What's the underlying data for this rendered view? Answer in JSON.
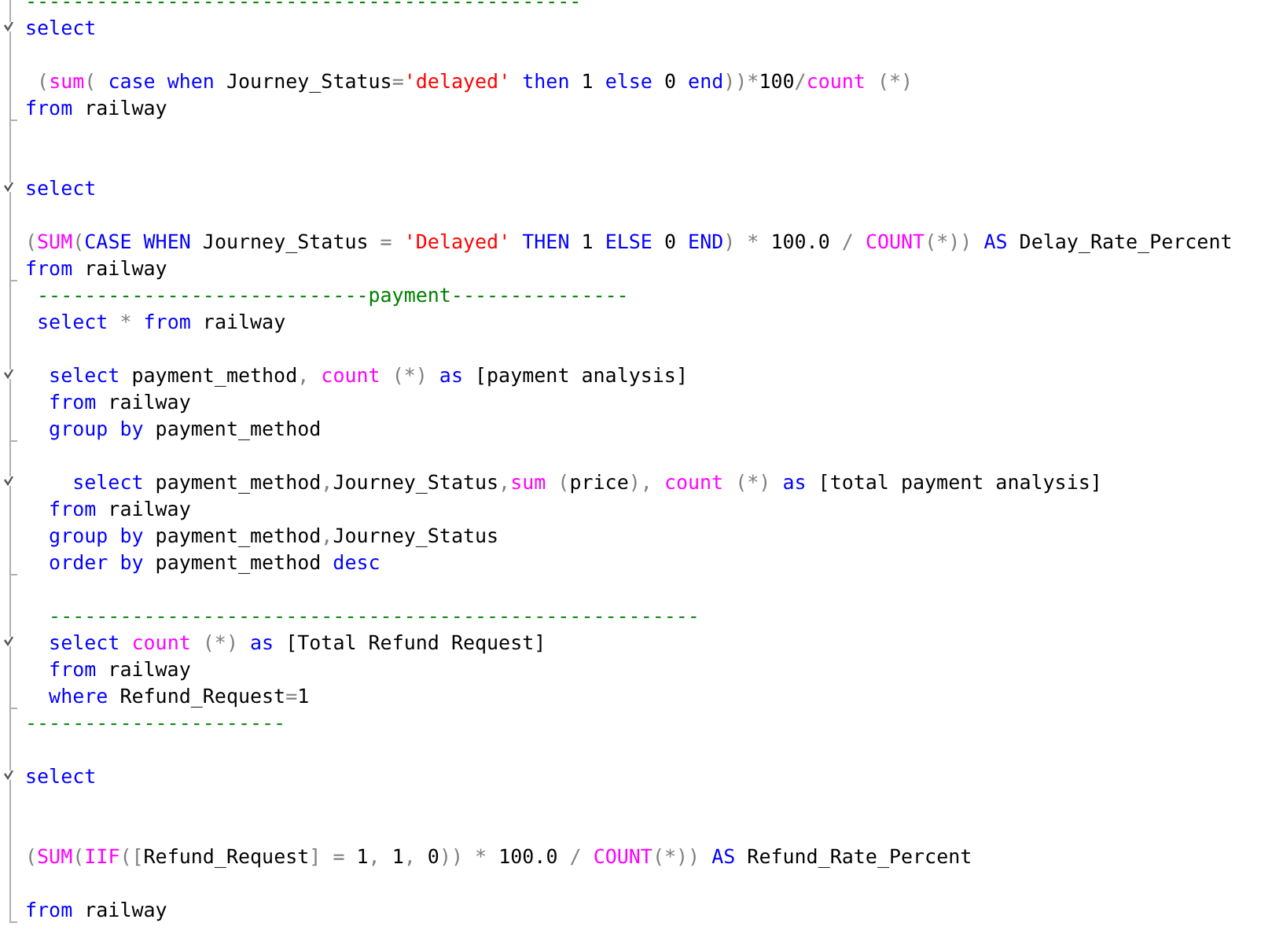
{
  "editor": {
    "lines": [
      {
        "kind": "code",
        "tokens": [
          {
            "kind": "cmt",
            "text": "-----------------------------------------------"
          }
        ]
      },
      {
        "kind": "code",
        "fold_start": true,
        "tokens": [
          {
            "kind": "kw",
            "text": "select"
          }
        ]
      },
      {
        "kind": "blank"
      },
      {
        "kind": "code",
        "tokens": [
          {
            "kind": "op",
            "text": " ("
          },
          {
            "kind": "fn",
            "text": "sum"
          },
          {
            "kind": "op",
            "text": "("
          },
          {
            "kind": "kw",
            "text": " case"
          },
          {
            "kind": "kw",
            "text": " when"
          },
          {
            "kind": "txt",
            "text": " Journey_Status"
          },
          {
            "kind": "op",
            "text": "="
          },
          {
            "kind": "str",
            "text": "'delayed'"
          },
          {
            "kind": "kw",
            "text": " then"
          },
          {
            "kind": "txt",
            "text": " 1"
          },
          {
            "kind": "kw",
            "text": " else"
          },
          {
            "kind": "txt",
            "text": " 0"
          },
          {
            "kind": "kw",
            "text": " end"
          },
          {
            "kind": "op",
            "text": "))*"
          },
          {
            "kind": "txt",
            "text": "100"
          },
          {
            "kind": "op",
            "text": "/"
          },
          {
            "kind": "fn",
            "text": "count"
          },
          {
            "kind": "op",
            "text": " (*)"
          }
        ]
      },
      {
        "kind": "code",
        "fold_end": true,
        "tokens": [
          {
            "kind": "kw",
            "text": "from"
          },
          {
            "kind": "txt",
            "text": " railway"
          }
        ]
      },
      {
        "kind": "blank"
      },
      {
        "kind": "blank"
      },
      {
        "kind": "code",
        "fold_start": true,
        "tokens": [
          {
            "kind": "kw",
            "text": "select"
          }
        ]
      },
      {
        "kind": "blank"
      },
      {
        "kind": "code",
        "tokens": [
          {
            "kind": "op",
            "text": "("
          },
          {
            "kind": "fn",
            "text": "SUM"
          },
          {
            "kind": "op",
            "text": "("
          },
          {
            "kind": "kw",
            "text": "CASE"
          },
          {
            "kind": "kw",
            "text": " WHEN"
          },
          {
            "kind": "txt",
            "text": " Journey_Status"
          },
          {
            "kind": "op",
            "text": " ="
          },
          {
            "kind": "str",
            "text": " 'Delayed'"
          },
          {
            "kind": "kw",
            "text": " THEN"
          },
          {
            "kind": "txt",
            "text": " 1"
          },
          {
            "kind": "kw",
            "text": " ELSE"
          },
          {
            "kind": "txt",
            "text": " 0"
          },
          {
            "kind": "kw",
            "text": " END"
          },
          {
            "kind": "op",
            "text": ") *"
          },
          {
            "kind": "txt",
            "text": " 100.0"
          },
          {
            "kind": "op",
            "text": " /"
          },
          {
            "kind": "fn",
            "text": " COUNT"
          },
          {
            "kind": "op",
            "text": "(*))"
          },
          {
            "kind": "kw",
            "text": " AS"
          },
          {
            "kind": "txt",
            "text": " Delay_Rate_Percent"
          }
        ]
      },
      {
        "kind": "code",
        "fold_end": true,
        "tokens": [
          {
            "kind": "kw",
            "text": "from"
          },
          {
            "kind": "txt",
            "text": " railway"
          }
        ]
      },
      {
        "kind": "code",
        "tokens": [
          {
            "kind": "cmt",
            "text": " ----------------------------payment---------------"
          }
        ]
      },
      {
        "kind": "code",
        "tokens": [
          {
            "kind": "kw",
            "text": " select"
          },
          {
            "kind": "op",
            "text": " *"
          },
          {
            "kind": "kw",
            "text": " from"
          },
          {
            "kind": "txt",
            "text": " railway"
          }
        ]
      },
      {
        "kind": "blank"
      },
      {
        "kind": "code",
        "fold_start": true,
        "tokens": [
          {
            "kind": "kw",
            "text": "  select"
          },
          {
            "kind": "txt",
            "text": " payment_method"
          },
          {
            "kind": "op",
            "text": ","
          },
          {
            "kind": "fn",
            "text": " count"
          },
          {
            "kind": "op",
            "text": " (*)"
          },
          {
            "kind": "kw",
            "text": " as"
          },
          {
            "kind": "txt",
            "text": " [payment analysis]"
          }
        ]
      },
      {
        "kind": "code",
        "tokens": [
          {
            "kind": "kw",
            "text": "  from"
          },
          {
            "kind": "txt",
            "text": " railway"
          }
        ]
      },
      {
        "kind": "code",
        "fold_end": true,
        "tokens": [
          {
            "kind": "kw",
            "text": "  group by"
          },
          {
            "kind": "txt",
            "text": " payment_method"
          }
        ]
      },
      {
        "kind": "blank"
      },
      {
        "kind": "code",
        "fold_start": true,
        "tokens": [
          {
            "kind": "kw",
            "text": "    select"
          },
          {
            "kind": "txt",
            "text": " payment_method"
          },
          {
            "kind": "op",
            "text": ","
          },
          {
            "kind": "txt",
            "text": "Journey_Status"
          },
          {
            "kind": "op",
            "text": ","
          },
          {
            "kind": "fn",
            "text": "sum"
          },
          {
            "kind": "op",
            "text": " ("
          },
          {
            "kind": "txt",
            "text": "price"
          },
          {
            "kind": "op",
            "text": "),"
          },
          {
            "kind": "fn",
            "text": " count"
          },
          {
            "kind": "op",
            "text": " (*)"
          },
          {
            "kind": "kw",
            "text": " as"
          },
          {
            "kind": "txt",
            "text": " [total payment analysis]"
          }
        ]
      },
      {
        "kind": "code",
        "tokens": [
          {
            "kind": "kw",
            "text": "  from"
          },
          {
            "kind": "txt",
            "text": " railway"
          }
        ]
      },
      {
        "kind": "code",
        "tokens": [
          {
            "kind": "kw",
            "text": "  group by"
          },
          {
            "kind": "txt",
            "text": " payment_method"
          },
          {
            "kind": "op",
            "text": ","
          },
          {
            "kind": "txt",
            "text": "Journey_Status"
          }
        ]
      },
      {
        "kind": "code",
        "fold_end": true,
        "tokens": [
          {
            "kind": "kw",
            "text": "  order by"
          },
          {
            "kind": "txt",
            "text": " payment_method"
          },
          {
            "kind": "kw",
            "text": " desc"
          }
        ]
      },
      {
        "kind": "blank"
      },
      {
        "kind": "code",
        "tokens": [
          {
            "kind": "cmt",
            "text": "  -------------------------------------------------------"
          }
        ]
      },
      {
        "kind": "code",
        "fold_start": true,
        "tokens": [
          {
            "kind": "kw",
            "text": "  select"
          },
          {
            "kind": "fn",
            "text": " count"
          },
          {
            "kind": "op",
            "text": " (*)"
          },
          {
            "kind": "kw",
            "text": " as"
          },
          {
            "kind": "txt",
            "text": " [Total Refund Request]"
          }
        ]
      },
      {
        "kind": "code",
        "tokens": [
          {
            "kind": "kw",
            "text": "  from"
          },
          {
            "kind": "txt",
            "text": " railway"
          }
        ]
      },
      {
        "kind": "code",
        "fold_end": true,
        "tokens": [
          {
            "kind": "kw",
            "text": "  where"
          },
          {
            "kind": "txt",
            "text": " Refund_Request"
          },
          {
            "kind": "op",
            "text": "="
          },
          {
            "kind": "txt",
            "text": "1"
          }
        ]
      },
      {
        "kind": "code",
        "tokens": [
          {
            "kind": "cmt",
            "text": "----------------------"
          }
        ]
      },
      {
        "kind": "blank"
      },
      {
        "kind": "code",
        "fold_start": true,
        "tokens": [
          {
            "kind": "kw",
            "text": "select"
          }
        ]
      },
      {
        "kind": "blank"
      },
      {
        "kind": "blank"
      },
      {
        "kind": "code",
        "tokens": [
          {
            "kind": "op",
            "text": "("
          },
          {
            "kind": "fn",
            "text": "SUM"
          },
          {
            "kind": "op",
            "text": "("
          },
          {
            "kind": "fn",
            "text": "IIF"
          },
          {
            "kind": "op",
            "text": "(["
          },
          {
            "kind": "txt",
            "text": "Refund_Request"
          },
          {
            "kind": "op",
            "text": "] ="
          },
          {
            "kind": "txt",
            "text": " 1"
          },
          {
            "kind": "op",
            "text": ","
          },
          {
            "kind": "txt",
            "text": " 1"
          },
          {
            "kind": "op",
            "text": ","
          },
          {
            "kind": "txt",
            "text": " 0"
          },
          {
            "kind": "op",
            "text": ")) *"
          },
          {
            "kind": "txt",
            "text": " 100.0"
          },
          {
            "kind": "op",
            "text": " /"
          },
          {
            "kind": "fn",
            "text": " COUNT"
          },
          {
            "kind": "op",
            "text": "(*))"
          },
          {
            "kind": "kw",
            "text": " AS"
          },
          {
            "kind": "txt",
            "text": " Refund_Rate_Percent"
          }
        ]
      },
      {
        "kind": "blank"
      },
      {
        "kind": "code",
        "fold_end": true,
        "tokens": [
          {
            "kind": "kw",
            "text": "from"
          },
          {
            "kind": "txt",
            "text": " railway"
          }
        ]
      }
    ]
  }
}
